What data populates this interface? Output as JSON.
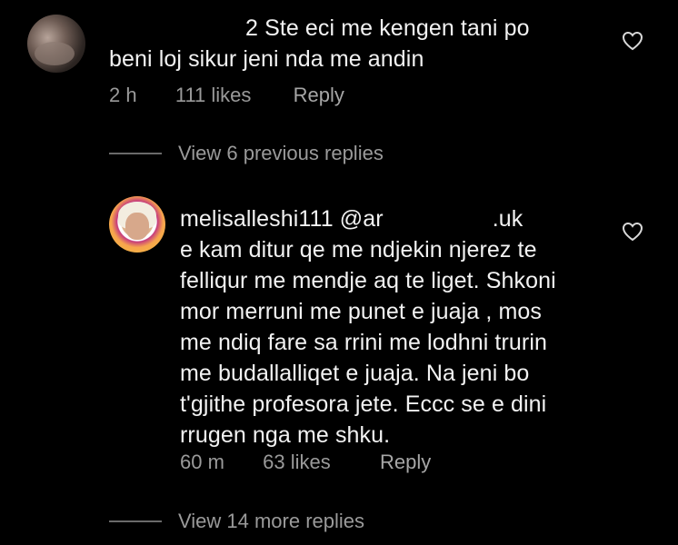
{
  "comments": [
    {
      "username_visible_part": "2",
      "text_line1": "Ste eci me kengen tani po",
      "text_line2": "beni loj sikur jeni nda me andin",
      "time": "2 h",
      "likes": "111 likes",
      "reply_label": "Reply",
      "icon": "heart-outline-icon"
    },
    {
      "username": "melisalleshi111",
      "mention_start": "@ar",
      "mention_end": ".uk",
      "lines": [
        "e kam ditur qe me ndjekin njerez te",
        "felliqur me mendje aq te liget. Shkoni",
        "mor merruni me punet e juaja , mos",
        "me ndiq fare sa rrini me lodhni trurin",
        "me budallalliqet e juaja. Na jeni bo",
        "t'gjithe profesora jete. Eccc se e dini",
        "rrugen nga me shku."
      ],
      "time": "60 m",
      "likes": "63 likes",
      "reply_label": "Reply",
      "icon": "heart-outline-icon"
    }
  ],
  "view_previous_replies": "View 6 previous replies",
  "view_more_replies": "View 14 more replies",
  "colors": {
    "background": "#000000",
    "text": "#f2f2f2",
    "muted": "#9a9a9a"
  }
}
